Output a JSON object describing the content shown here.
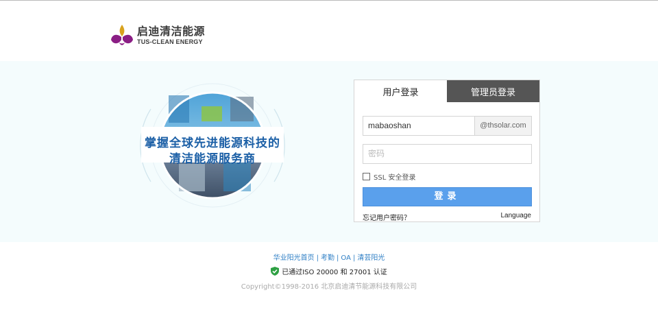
{
  "header": {
    "logo_cn": "启迪清洁能源",
    "logo_en": "TUS-CLEAN ENERGY",
    "logo_icon": "tus-clean-energy-logo"
  },
  "emblem": {
    "slogan_line1": "掌握全球先进能源科技的",
    "slogan_line2": "清洁能源服务商"
  },
  "login": {
    "tabs": [
      {
        "label": "用户登录",
        "active": true
      },
      {
        "label": "管理员登录",
        "active": false
      }
    ],
    "username_value": "mabaoshan",
    "domain_suffix": "@thsolar.com",
    "password_placeholder": "密码",
    "ssl_label": "SSL 安全登录",
    "ssl_checked": false,
    "submit_label": "登录",
    "forgot_label": "忘记用户密码？",
    "language_label": "Language"
  },
  "footer": {
    "links": [
      "华业阳光首页",
      "考勤",
      "OA",
      "清芸阳光"
    ],
    "iso_text": "已通过ISO 20000 和 27001 认证",
    "copyright": "Copyright©1998-2016 北京启迪清节能源科技有限公司"
  },
  "colors": {
    "brand_purple": "#8b1e85",
    "brand_gold": "#d8a21e",
    "button_blue": "#5aa0ec",
    "admin_tab": "#555555",
    "link_blue": "#2f7fc5"
  }
}
